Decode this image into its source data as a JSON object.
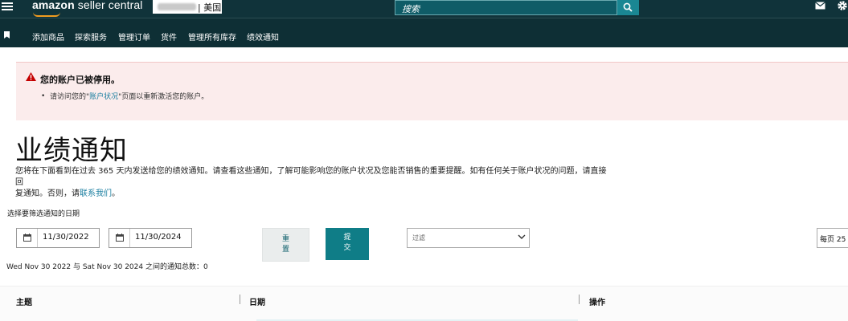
{
  "header": {
    "logo_bold": "amazon",
    "logo_rest": " seller central",
    "marketplace_label": "| 美国",
    "search_placeholder": "搜索",
    "icons": [
      "menu-icon",
      "search-icon",
      "mail-icon",
      "gear-icon"
    ]
  },
  "nav": {
    "items": [
      "添加商品",
      "探索服务",
      "管理订单",
      "货件",
      "管理所有库存",
      "绩效通知"
    ]
  },
  "alert": {
    "title": "您的账户已被停用。",
    "text_before": "请访问您的\"",
    "link": "账户状况",
    "text_after": "\"页面以重新激活您的账户。"
  },
  "page": {
    "title": "业绩通知",
    "desc_line1": "您将在下面看到在过去 365 天内发送给您的绩效通知。请查看这些通知，了解可能影响您的账户状况及您能否销售的重要提醒。如有任何关于账户状况的问题，请直接回",
    "desc_line2": "复通知。否则，请",
    "desc_link": "联系我们",
    "desc_end": "。"
  },
  "filters": {
    "label": "选择要筛选通知的日期",
    "start_date": "11/30/2022",
    "end_date": "11/30/2024",
    "reset_line1": "重",
    "reset_line2": "置",
    "submit_line1": "提",
    "submit_line2": "交",
    "filter_placeholder": "过滤",
    "per_page": "每页 25"
  },
  "summary": "Wed Nov 30 2022 与 Sat Nov 30 2024 之间的通知总数：0",
  "table": {
    "columns": [
      "主题",
      "日期",
      "操作"
    ]
  },
  "colors": {
    "header_bg": "#10333a",
    "nav_bg": "#0e2f35",
    "accent_teal": "#0f7d87",
    "alert_bg": "#fbecec",
    "alert_icon": "#c40000",
    "logo_smile": "#f29c1f"
  }
}
